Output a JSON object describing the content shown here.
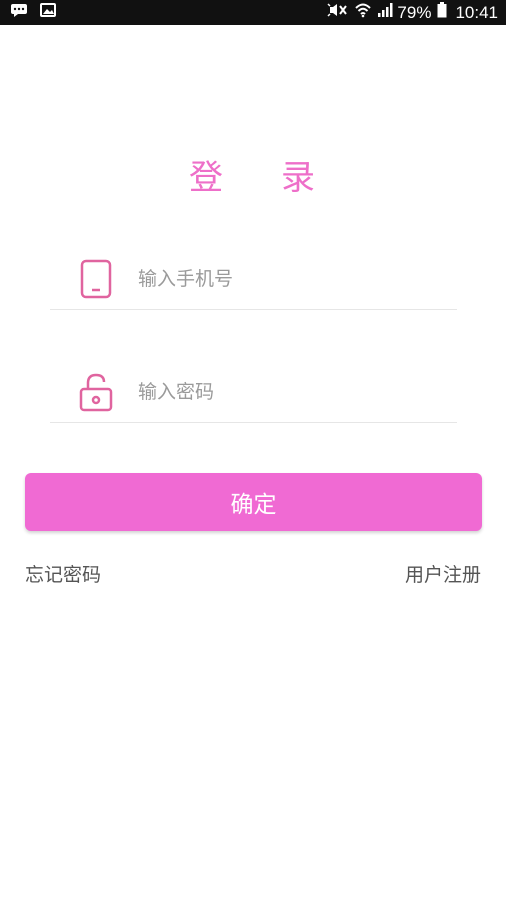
{
  "status_bar": {
    "battery": "79%",
    "time": "10:41",
    "icons": [
      "message-icon",
      "image-icon",
      "mute-icon",
      "wifi-icon",
      "signal-icon",
      "battery-icon"
    ]
  },
  "login": {
    "title_part1": "登",
    "title_part2": "录",
    "phone_placeholder": "输入手机号",
    "password_placeholder": "输入密码",
    "confirm_label": "确定",
    "forgot_password": "忘记密码",
    "register": "用户注册"
  },
  "colors": {
    "accent": "#f06ad3",
    "title": "#ee6fc9",
    "icon": "#e0649f"
  }
}
